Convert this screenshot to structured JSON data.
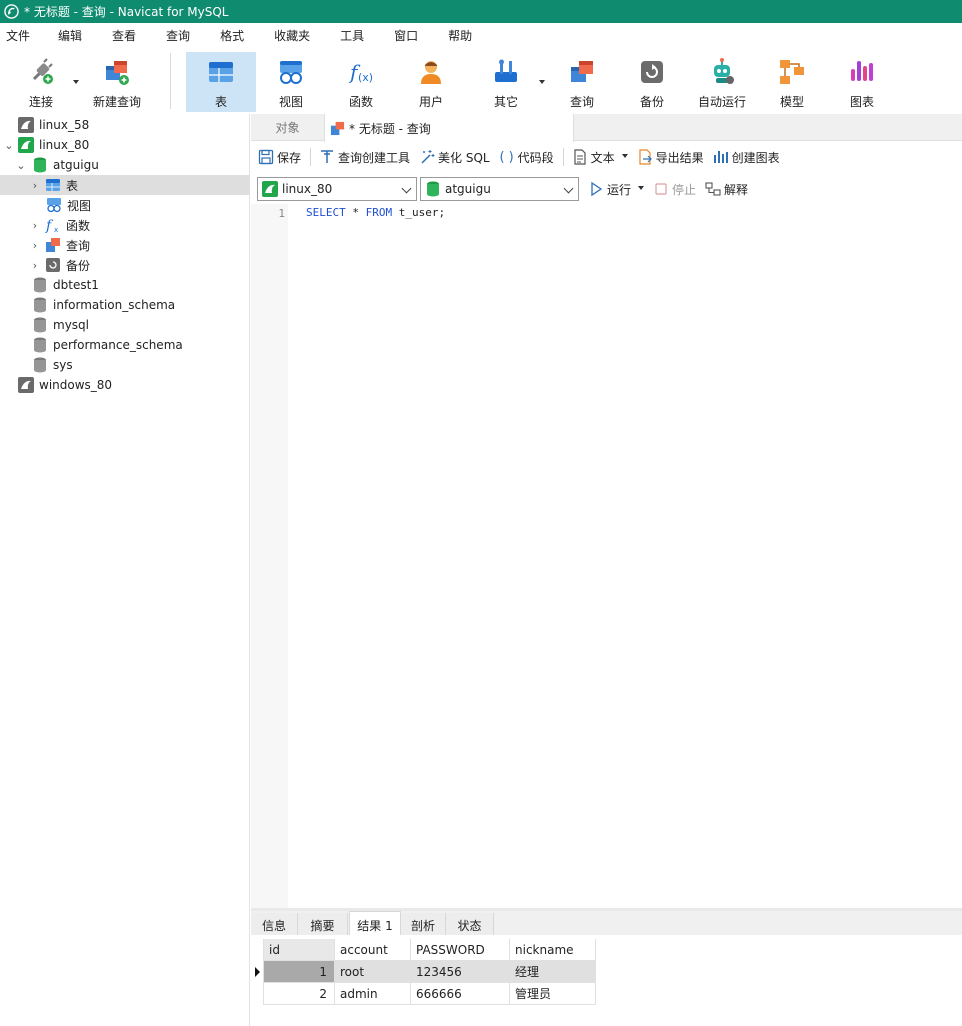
{
  "window": {
    "title": "* 无标题 - 查询 - Navicat for MySQL"
  },
  "menu": [
    "文件",
    "编辑",
    "查看",
    "查询",
    "格式",
    "收藏夹",
    "工具",
    "窗口",
    "帮助"
  ],
  "toolbar": {
    "connect": "连接",
    "new_query": "新建查询",
    "table": "表",
    "view": "视图",
    "function": "函数",
    "user": "用户",
    "other": "其它",
    "query": "查询",
    "backup": "备份",
    "automation": "自动运行",
    "model": "模型",
    "chart": "图表",
    "active": "表"
  },
  "tree": {
    "items": [
      {
        "label": "linux_58",
        "icon": "mysql-connection-icon",
        "state": "closed"
      },
      {
        "label": "linux_80",
        "icon": "mysql-connection-icon",
        "state": "open"
      },
      {
        "label": "atguigu",
        "icon": "database-icon",
        "state": "open"
      },
      {
        "label": "表",
        "icon": "table-icon",
        "selected": true
      },
      {
        "label": "视图",
        "icon": "view-icon"
      },
      {
        "label": "函数",
        "icon": "function-icon"
      },
      {
        "label": "查询",
        "icon": "query-icon"
      },
      {
        "label": "备份",
        "icon": "backup-icon"
      },
      {
        "label": "dbtest1",
        "icon": "database-icon"
      },
      {
        "label": "information_schema",
        "icon": "database-icon"
      },
      {
        "label": "mysql",
        "icon": "database-icon"
      },
      {
        "label": "performance_schema",
        "icon": "database-icon"
      },
      {
        "label": "sys",
        "icon": "database-icon"
      },
      {
        "label": "windows_80",
        "icon": "mysql-connection-icon",
        "state": "closed"
      }
    ]
  },
  "tabs": {
    "objects": "对象",
    "query": "* 无标题 - 查询"
  },
  "query_toolbar": {
    "save": "保存",
    "query_builder": "查询创建工具",
    "beautify": "美化 SQL",
    "snippet": "代码段",
    "text": "文本",
    "export": "导出结果",
    "create_chart": "创建图表"
  },
  "selectors": {
    "connection": "linux_80",
    "database": "atguigu",
    "run": "运行",
    "stop": "停止",
    "explain": "解释"
  },
  "editor": {
    "line_number": "1",
    "kw_select": "SELECT",
    "star": " * ",
    "kw_from": "FROM",
    "table": " t_user;"
  },
  "result_tabs": [
    "信息",
    "摘要",
    "结果 1",
    "剖析",
    "状态"
  ],
  "result_active": "结果 1",
  "grid": {
    "columns": [
      "id",
      "account",
      "PASSWORD",
      "nickname"
    ],
    "rows": [
      [
        "1",
        "root",
        "123456",
        "经理"
      ],
      [
        "2",
        "admin",
        "666666",
        "管理员"
      ]
    ]
  },
  "colors": {
    "titlebar": "#0f8b6f",
    "accent": "#2e6fb5",
    "keyword": "#1f4fd1"
  }
}
